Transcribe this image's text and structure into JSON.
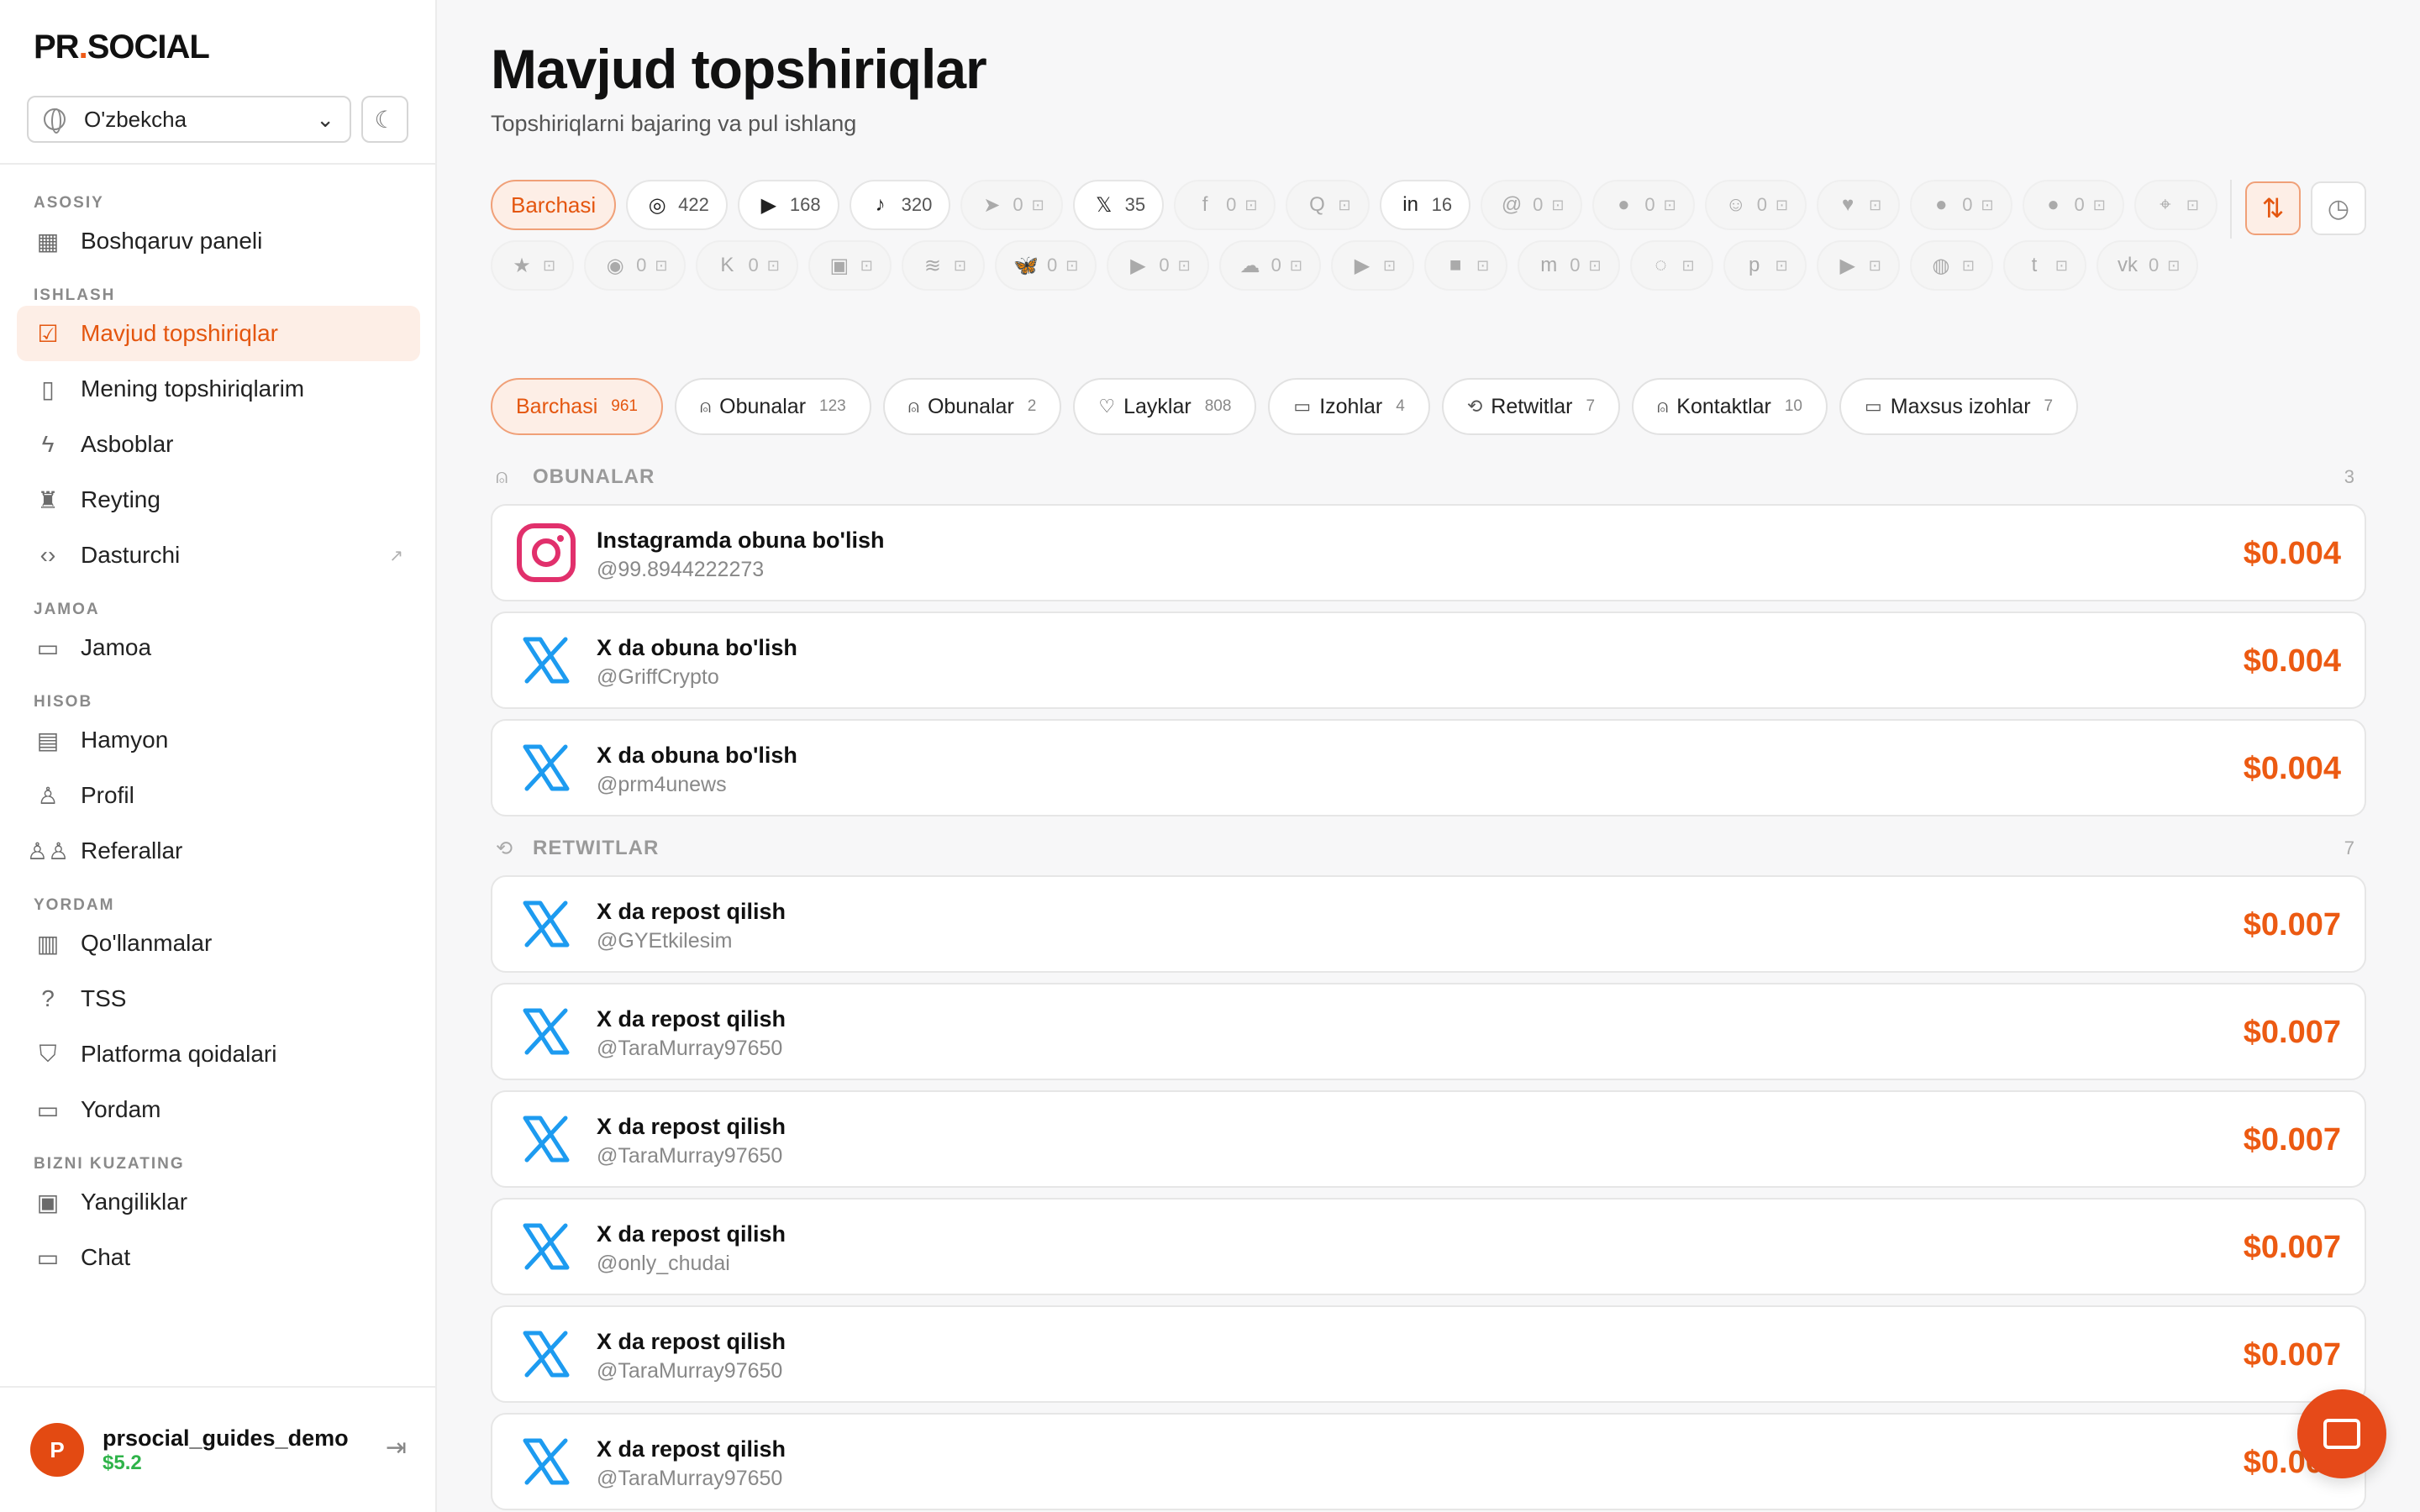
{
  "brand": {
    "left": "PR",
    "dot": ".",
    "right": "SOCIAL",
    "accent": "#ef5a17"
  },
  "lang": {
    "value": "O'zbekcha"
  },
  "sidebar": {
    "sections": [
      {
        "label": "ASOSIY",
        "items": [
          {
            "label": "Boshqaruv paneli",
            "icon": "grid-icon"
          }
        ]
      },
      {
        "label": "ISHLASH",
        "items": [
          {
            "label": "Mavjud topshiriqlar",
            "icon": "checkbox-icon",
            "active": true
          },
          {
            "label": "Mening topshiriqlarim",
            "icon": "file-icon"
          },
          {
            "label": "Asboblar",
            "icon": "bolt-icon"
          },
          {
            "label": "Reyting",
            "icon": "trophy-icon"
          },
          {
            "label": "Dasturchi",
            "icon": "code-icon",
            "external": true
          }
        ]
      },
      {
        "label": "JAMOA",
        "items": [
          {
            "label": "Jamoa",
            "icon": "chat-icon"
          }
        ]
      },
      {
        "label": "HISOB",
        "items": [
          {
            "label": "Hamyon",
            "icon": "wallet-icon"
          },
          {
            "label": "Profil",
            "icon": "user-icon"
          },
          {
            "label": "Referallar",
            "icon": "users-icon"
          }
        ]
      },
      {
        "label": "YORDAM",
        "items": [
          {
            "label": "Qo'llanmalar",
            "icon": "book-icon"
          },
          {
            "label": "TSS",
            "icon": "question-icon"
          },
          {
            "label": "Platforma qoidalari",
            "icon": "shield-icon"
          },
          {
            "label": "Yordam",
            "icon": "message-icon"
          }
        ]
      },
      {
        "label": "BIZNI KUZATING",
        "items": [
          {
            "label": "Yangiliklar",
            "icon": "news-icon"
          },
          {
            "label": "Chat",
            "icon": "chat-icon"
          }
        ]
      }
    ]
  },
  "user": {
    "avatar": "P",
    "name": "prsocial_guides_demo",
    "balance": "$5.2"
  },
  "page": {
    "title": "Mavjud topshiriqlar",
    "subtitle": "Topshiriqlarni bajaring va pul ishlang"
  },
  "platforms": [
    {
      "label": "Barchasi",
      "active": true
    },
    {
      "icon": "instagram-icon",
      "glyph": "◎",
      "count": "422"
    },
    {
      "icon": "youtube-icon",
      "glyph": "▶",
      "count": "168"
    },
    {
      "icon": "tiktok-icon",
      "glyph": "♪",
      "count": "320"
    },
    {
      "icon": "telegram-icon",
      "glyph": "➤",
      "count": "0",
      "locked": true
    },
    {
      "icon": "x-icon",
      "glyph": "𝕏",
      "count": "35"
    },
    {
      "icon": "facebook-icon",
      "glyph": "f",
      "count": "0",
      "locked": true
    },
    {
      "icon": "quora-icon",
      "glyph": "Q",
      "count": "",
      "locked": true
    },
    {
      "icon": "linkedin-icon",
      "glyph": "in",
      "count": "16"
    },
    {
      "icon": "threads-icon",
      "glyph": "@",
      "count": "0",
      "locked": true
    },
    {
      "icon": "reddit-icon",
      "glyph": "●",
      "count": "0",
      "locked": true
    },
    {
      "icon": "snapchat-icon",
      "glyph": "☺",
      "count": "0",
      "locked": true
    },
    {
      "icon": "heart-icon",
      "glyph": "♥",
      "count": "",
      "locked": true
    },
    {
      "icon": "github-icon",
      "glyph": "●",
      "count": "0",
      "locked": true
    },
    {
      "icon": "chat-bubble-icon",
      "glyph": "●",
      "count": "0",
      "locked": true
    },
    {
      "icon": "location-icon",
      "glyph": "⌖",
      "count": "",
      "locked": true
    },
    {
      "icon": "star-icon",
      "glyph": "★",
      "count": "",
      "locked": true
    },
    {
      "icon": "discord-icon",
      "glyph": "◉",
      "count": "0",
      "locked": true
    },
    {
      "icon": "kick-icon",
      "glyph": "K",
      "count": "0",
      "locked": true
    },
    {
      "icon": "twitch-icon",
      "glyph": "▣",
      "count": "",
      "locked": true
    },
    {
      "icon": "spotify-icon",
      "glyph": "≋",
      "count": "",
      "locked": true
    },
    {
      "icon": "bluesky-icon",
      "glyph": "🦋",
      "count": "0",
      "locked": true
    },
    {
      "icon": "play-box-icon",
      "glyph": "▶",
      "count": "0",
      "locked": true
    },
    {
      "icon": "cloud-icon",
      "glyph": "☁",
      "count": "0",
      "locked": true
    },
    {
      "icon": "play-circle-icon",
      "glyph": "▶",
      "count": "",
      "locked": true
    },
    {
      "icon": "video-icon",
      "glyph": "■",
      "count": "",
      "locked": true
    },
    {
      "icon": "mastodon-icon",
      "glyph": "m",
      "count": "0",
      "locked": true
    },
    {
      "icon": "wechat-icon",
      "glyph": "◌",
      "count": "",
      "locked": true
    },
    {
      "icon": "pinterest-icon",
      "glyph": "p",
      "count": "",
      "locked": true
    },
    {
      "icon": "play-round-icon",
      "glyph": "▶",
      "count": "",
      "locked": true
    },
    {
      "icon": "dribbble-icon",
      "glyph": "◍",
      "count": "",
      "locked": true
    },
    {
      "icon": "tumblr-icon",
      "glyph": "t",
      "count": "",
      "locked": true
    },
    {
      "icon": "vk-icon",
      "glyph": "vk",
      "count": "0",
      "locked": true
    }
  ],
  "task_types": [
    {
      "label": "Barchasi",
      "count": "961",
      "active": true,
      "icon": ""
    },
    {
      "label": "Obunalar",
      "count": "123",
      "icon": "user-plus-icon"
    },
    {
      "label": "Obunalar",
      "count": "2",
      "icon": "user-plus-icon"
    },
    {
      "label": "Layklar",
      "count": "808",
      "icon": "heart-icon"
    },
    {
      "label": "Izohlar",
      "count": "4",
      "icon": "comment-icon"
    },
    {
      "label": "Retwitlar",
      "count": "7",
      "icon": "repeat-icon"
    },
    {
      "label": "Kontaktlar",
      "count": "10",
      "icon": "user-plus-icon"
    },
    {
      "label": "Maxsus izohlar",
      "count": "7",
      "icon": "comment-icon"
    }
  ],
  "groups": [
    {
      "label": "OBUNALAR",
      "count": "3",
      "icon": "user-plus-icon",
      "tasks": [
        {
          "platform": "instagram",
          "title": "Instagramda obuna bo'lish",
          "handle": "@99.8944222273",
          "price": "$0.004"
        },
        {
          "platform": "x",
          "title": "X da obuna bo'lish",
          "handle": "@GriffCrypto",
          "price": "$0.004"
        },
        {
          "platform": "x",
          "title": "X da obuna bo'lish",
          "handle": "@prm4unews",
          "price": "$0.004"
        }
      ]
    },
    {
      "label": "RETWITLAR",
      "count": "7",
      "icon": "repeat-icon",
      "tasks": [
        {
          "platform": "x",
          "title": "X da repost qilish",
          "handle": "@GYEtkilesim",
          "price": "$0.007"
        },
        {
          "platform": "x",
          "title": "X da repost qilish",
          "handle": "@TaraMurray97650",
          "price": "$0.007"
        },
        {
          "platform": "x",
          "title": "X da repost qilish",
          "handle": "@TaraMurray97650",
          "price": "$0.007"
        },
        {
          "platform": "x",
          "title": "X da repost qilish",
          "handle": "@only_chudai",
          "price": "$0.007"
        },
        {
          "platform": "x",
          "title": "X da repost qilish",
          "handle": "@TaraMurray97650",
          "price": "$0.007"
        },
        {
          "platform": "x",
          "title": "X da repost qilish",
          "handle": "@TaraMurray97650",
          "price": "$0.007"
        }
      ]
    }
  ],
  "colors": {
    "accent": "#ec5a12",
    "x_blue": "#1d9bf0",
    "instagram": "#e1306c",
    "balance": "#2fb34a"
  }
}
